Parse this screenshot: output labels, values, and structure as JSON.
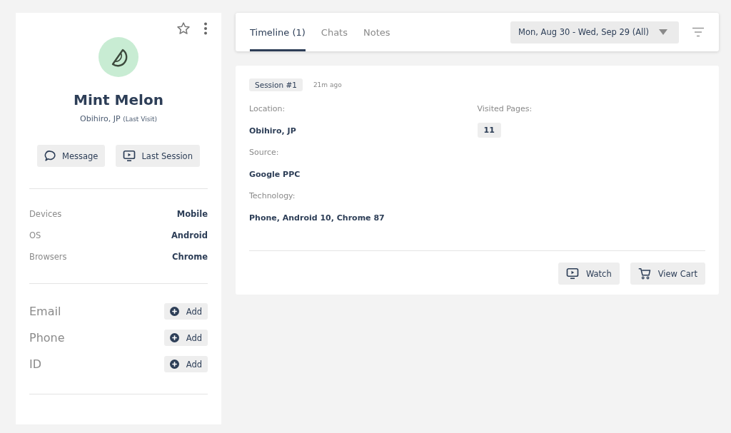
{
  "profile": {
    "name": "Mint Melon",
    "location": "Obihiro, JP",
    "location_note": "(Last Visit)",
    "starred": false,
    "buttons": [
      {
        "kind": "message",
        "label": "Message"
      },
      {
        "kind": "session",
        "label": "Last Session"
      }
    ]
  },
  "attributes": [
    {
      "label": "Devices",
      "value": "Mobile"
    },
    {
      "label": "OS",
      "value": "Android"
    },
    {
      "label": "Browsers",
      "value": "Chrome"
    }
  ],
  "contacts": [
    {
      "label": "Email",
      "button": "Add"
    },
    {
      "label": "Phone",
      "button": "Add"
    },
    {
      "label": "ID",
      "button": "Add"
    }
  ],
  "tabs": [
    {
      "label": "Timeline (1)",
      "selected": true
    },
    {
      "label": "Chats",
      "selected": false
    },
    {
      "label": "Notes",
      "selected": false
    }
  ],
  "date_range": "Mon, Aug 30 - Wed, Sep 29 (All)",
  "session": {
    "badge": "Session #1",
    "time": "21m ago",
    "fields": [
      {
        "label": "Location:",
        "value": "Obihiro, JP"
      },
      {
        "label": "Source:",
        "value": "Google PPC"
      },
      {
        "label": "Technology:",
        "value": "Phone, Android 10, Chrome 87"
      }
    ],
    "visited_label": "Visited Pages:",
    "visited_count": "11",
    "actions": [
      {
        "kind": "watch",
        "label": "Watch"
      },
      {
        "kind": "cart",
        "label": "View Cart"
      }
    ]
  }
}
